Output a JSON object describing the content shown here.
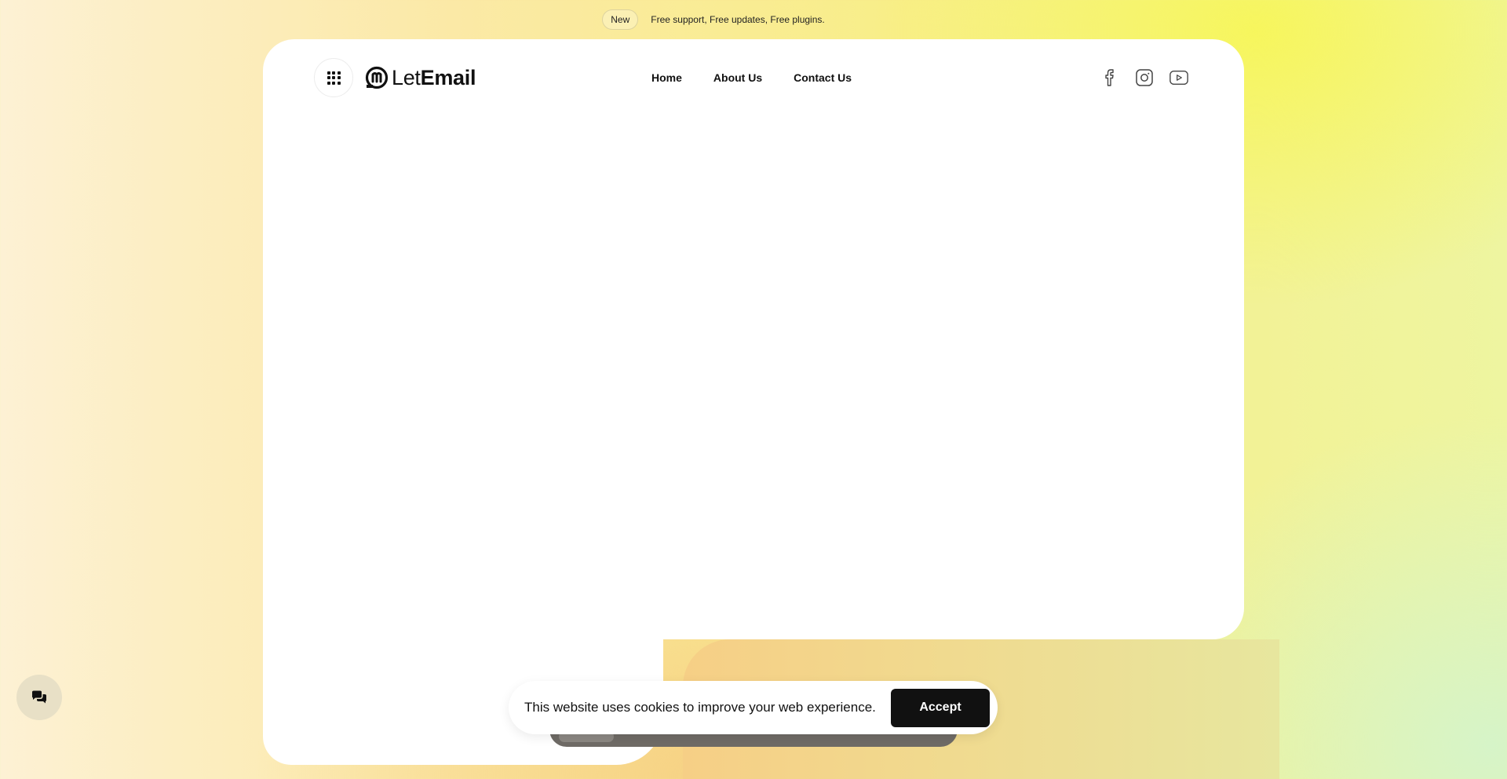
{
  "announcement": {
    "badge": "New",
    "text": "Free support, Free updates, Free plugins."
  },
  "header": {
    "logo": {
      "light": "Let",
      "bold": "Email"
    },
    "nav": [
      {
        "label": "Home"
      },
      {
        "label": "About Us"
      },
      {
        "label": "Contact Us"
      }
    ],
    "social": [
      "facebook-icon",
      "instagram-icon",
      "youtube-icon"
    ]
  },
  "cookie": {
    "message": "This website uses cookies to improve your web experience.",
    "accept_label": "Accept"
  },
  "chat": {
    "icon": "chat-icon"
  },
  "colors": {
    "brand_dark": "#111111",
    "background_yellow": "#F7F65A",
    "background_green": "#D6F4C8",
    "background_orange": "#F6CE82"
  }
}
